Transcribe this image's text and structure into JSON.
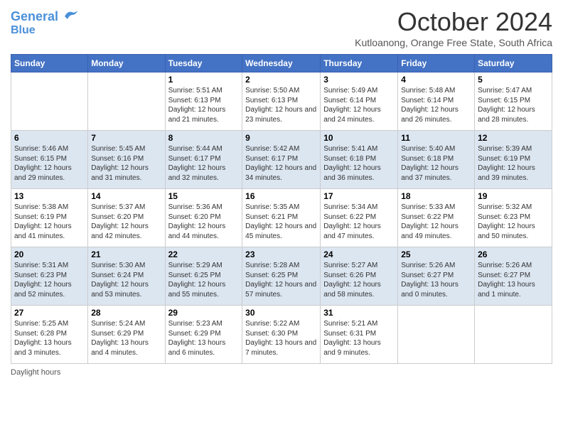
{
  "header": {
    "logo_line1": "General",
    "logo_line2": "Blue",
    "month": "October 2024",
    "location": "Kutloanong, Orange Free State, South Africa"
  },
  "days_of_week": [
    "Sunday",
    "Monday",
    "Tuesday",
    "Wednesday",
    "Thursday",
    "Friday",
    "Saturday"
  ],
  "weeks": [
    [
      {
        "day": "",
        "info": ""
      },
      {
        "day": "",
        "info": ""
      },
      {
        "day": "1",
        "info": "Sunrise: 5:51 AM\nSunset: 6:13 PM\nDaylight: 12 hours and 21 minutes."
      },
      {
        "day": "2",
        "info": "Sunrise: 5:50 AM\nSunset: 6:13 PM\nDaylight: 12 hours and 23 minutes."
      },
      {
        "day": "3",
        "info": "Sunrise: 5:49 AM\nSunset: 6:14 PM\nDaylight: 12 hours and 24 minutes."
      },
      {
        "day": "4",
        "info": "Sunrise: 5:48 AM\nSunset: 6:14 PM\nDaylight: 12 hours and 26 minutes."
      },
      {
        "day": "5",
        "info": "Sunrise: 5:47 AM\nSunset: 6:15 PM\nDaylight: 12 hours and 28 minutes."
      }
    ],
    [
      {
        "day": "6",
        "info": "Sunrise: 5:46 AM\nSunset: 6:15 PM\nDaylight: 12 hours and 29 minutes."
      },
      {
        "day": "7",
        "info": "Sunrise: 5:45 AM\nSunset: 6:16 PM\nDaylight: 12 hours and 31 minutes."
      },
      {
        "day": "8",
        "info": "Sunrise: 5:44 AM\nSunset: 6:17 PM\nDaylight: 12 hours and 32 minutes."
      },
      {
        "day": "9",
        "info": "Sunrise: 5:42 AM\nSunset: 6:17 PM\nDaylight: 12 hours and 34 minutes."
      },
      {
        "day": "10",
        "info": "Sunrise: 5:41 AM\nSunset: 6:18 PM\nDaylight: 12 hours and 36 minutes."
      },
      {
        "day": "11",
        "info": "Sunrise: 5:40 AM\nSunset: 6:18 PM\nDaylight: 12 hours and 37 minutes."
      },
      {
        "day": "12",
        "info": "Sunrise: 5:39 AM\nSunset: 6:19 PM\nDaylight: 12 hours and 39 minutes."
      }
    ],
    [
      {
        "day": "13",
        "info": "Sunrise: 5:38 AM\nSunset: 6:19 PM\nDaylight: 12 hours and 41 minutes."
      },
      {
        "day": "14",
        "info": "Sunrise: 5:37 AM\nSunset: 6:20 PM\nDaylight: 12 hours and 42 minutes."
      },
      {
        "day": "15",
        "info": "Sunrise: 5:36 AM\nSunset: 6:20 PM\nDaylight: 12 hours and 44 minutes."
      },
      {
        "day": "16",
        "info": "Sunrise: 5:35 AM\nSunset: 6:21 PM\nDaylight: 12 hours and 45 minutes."
      },
      {
        "day": "17",
        "info": "Sunrise: 5:34 AM\nSunset: 6:22 PM\nDaylight: 12 hours and 47 minutes."
      },
      {
        "day": "18",
        "info": "Sunrise: 5:33 AM\nSunset: 6:22 PM\nDaylight: 12 hours and 49 minutes."
      },
      {
        "day": "19",
        "info": "Sunrise: 5:32 AM\nSunset: 6:23 PM\nDaylight: 12 hours and 50 minutes."
      }
    ],
    [
      {
        "day": "20",
        "info": "Sunrise: 5:31 AM\nSunset: 6:23 PM\nDaylight: 12 hours and 52 minutes."
      },
      {
        "day": "21",
        "info": "Sunrise: 5:30 AM\nSunset: 6:24 PM\nDaylight: 12 hours and 53 minutes."
      },
      {
        "day": "22",
        "info": "Sunrise: 5:29 AM\nSunset: 6:25 PM\nDaylight: 12 hours and 55 minutes."
      },
      {
        "day": "23",
        "info": "Sunrise: 5:28 AM\nSunset: 6:25 PM\nDaylight: 12 hours and 57 minutes."
      },
      {
        "day": "24",
        "info": "Sunrise: 5:27 AM\nSunset: 6:26 PM\nDaylight: 12 hours and 58 minutes."
      },
      {
        "day": "25",
        "info": "Sunrise: 5:26 AM\nSunset: 6:27 PM\nDaylight: 13 hours and 0 minutes."
      },
      {
        "day": "26",
        "info": "Sunrise: 5:26 AM\nSunset: 6:27 PM\nDaylight: 13 hours and 1 minute."
      }
    ],
    [
      {
        "day": "27",
        "info": "Sunrise: 5:25 AM\nSunset: 6:28 PM\nDaylight: 13 hours and 3 minutes."
      },
      {
        "day": "28",
        "info": "Sunrise: 5:24 AM\nSunset: 6:29 PM\nDaylight: 13 hours and 4 minutes."
      },
      {
        "day": "29",
        "info": "Sunrise: 5:23 AM\nSunset: 6:29 PM\nDaylight: 13 hours and 6 minutes."
      },
      {
        "day": "30",
        "info": "Sunrise: 5:22 AM\nSunset: 6:30 PM\nDaylight: 13 hours and 7 minutes."
      },
      {
        "day": "31",
        "info": "Sunrise: 5:21 AM\nSunset: 6:31 PM\nDaylight: 13 hours and 9 minutes."
      },
      {
        "day": "",
        "info": ""
      },
      {
        "day": "",
        "info": ""
      }
    ]
  ],
  "footer": {
    "label": "Daylight hours"
  }
}
